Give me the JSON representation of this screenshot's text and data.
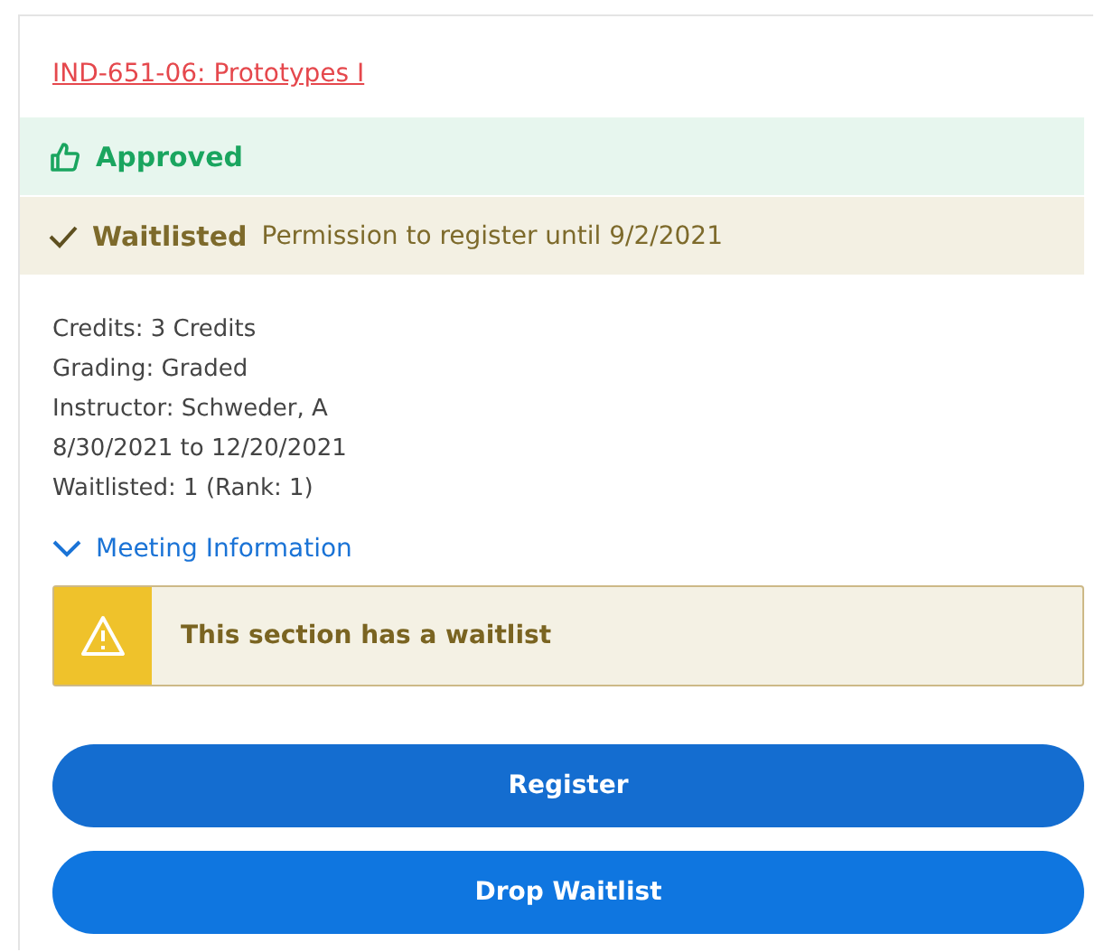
{
  "course": {
    "title": "IND-651-06: Prototypes I"
  },
  "statuses": [
    {
      "kind": "approved",
      "label": "Approved"
    },
    {
      "kind": "waitlisted",
      "label": "Waitlisted",
      "note": "Permission to register until 9/2/2021"
    }
  ],
  "details": [
    "Credits: 3 Credits",
    "Grading: Graded",
    "Instructor: Schweder, A",
    "8/30/2021 to 12/20/2021",
    "Waitlisted:  1 (Rank: 1)"
  ],
  "meeting": {
    "label": "Meeting Information",
    "expanded": false
  },
  "alert": {
    "kind": "warning",
    "text": "This section has a waitlist"
  },
  "buttons": [
    {
      "label": "Register"
    },
    {
      "label": "Drop Waitlist"
    }
  ]
}
